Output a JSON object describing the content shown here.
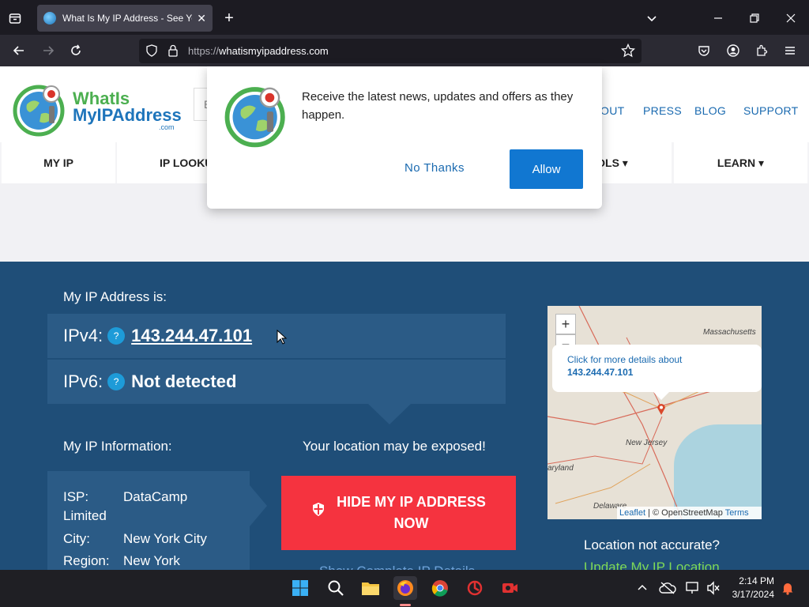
{
  "browser": {
    "tab_title": "What Is My IP Address - See You",
    "url_protocol": "https://",
    "url_host": "whatismyipaddress.com"
  },
  "site": {
    "logo_line1": "WhatIs",
    "logo_line2": "MyIPAddress",
    "logo_suffix": ".com",
    "search_placeholder": "E",
    "topnav": [
      "OUT",
      "PRESS",
      "BLOG",
      "SUPPORT"
    ],
    "menu": [
      "MY IP",
      "IP LOOKU",
      "OLS ▾",
      "LEARN ▾"
    ]
  },
  "notification": {
    "message": "Receive the latest news, updates and offers as they happen.",
    "no_label": "No Thanks",
    "allow_label": "Allow"
  },
  "ip": {
    "heading": "My IP Address is:",
    "ipv4_label": "IPv4:",
    "ipv4_value": "143.244.47.101",
    "ipv6_label": "IPv6:",
    "ipv6_value": "Not detected",
    "help_glyph": "?"
  },
  "info": {
    "heading": "My IP Information:",
    "isp_label": "ISP:",
    "isp_value": "DataCamp",
    "isp_value2": "Limited",
    "city_label": "City:",
    "city_value": "New York City",
    "region_label": "Region:",
    "region_value": "New York"
  },
  "exposure": {
    "warning": "Your location may be exposed!",
    "button_line1": "HIDE MY IP ADDRESS",
    "button_line2": "NOW",
    "below_link": "Show Complete IP Details"
  },
  "map": {
    "zoom_in": "+",
    "zoom_out": "−",
    "popup_line1": "Click for more details about",
    "popup_line2": "143.244.47.101",
    "labels": [
      "Massachusetts",
      "New Jersey",
      "aryland",
      "Delaware"
    ],
    "attr_leaflet": "Leaflet",
    "attr_sep": " | © OpenStreetMap ",
    "attr_terms": "Terms",
    "not_accurate": "Location not accurate?",
    "update_link": "Update My IP Location"
  },
  "taskbar": {
    "time": "2:14 PM",
    "date": "3/17/2024"
  }
}
